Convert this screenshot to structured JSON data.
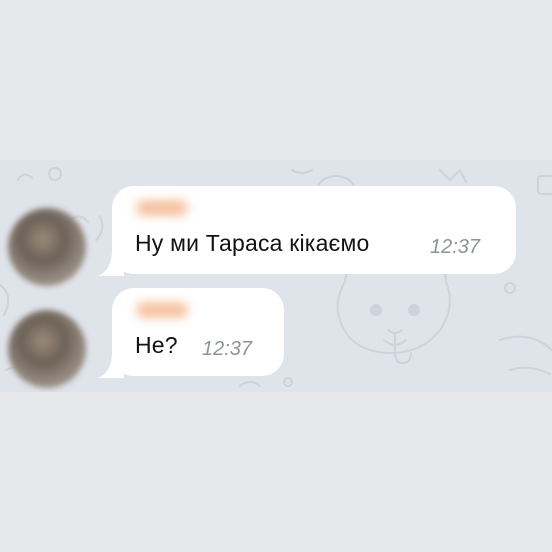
{
  "colors": {
    "page_background": "#e7e8eb",
    "chat_background": "#dfe3ea",
    "bubble": "#ffffff",
    "sender_name_blur": "#f5b78f",
    "message_text": "#121212",
    "timestamp": "#8e9399"
  },
  "messages": [
    {
      "sender": "",
      "text": "Ну ми Тараса кікаємо",
      "time": "12:37"
    },
    {
      "sender": "",
      "text": "Не?",
      "time": "12:37"
    }
  ],
  "icons": {
    "avatar": "avatar-blurred",
    "background_pattern": "doodle-pattern-cat"
  }
}
